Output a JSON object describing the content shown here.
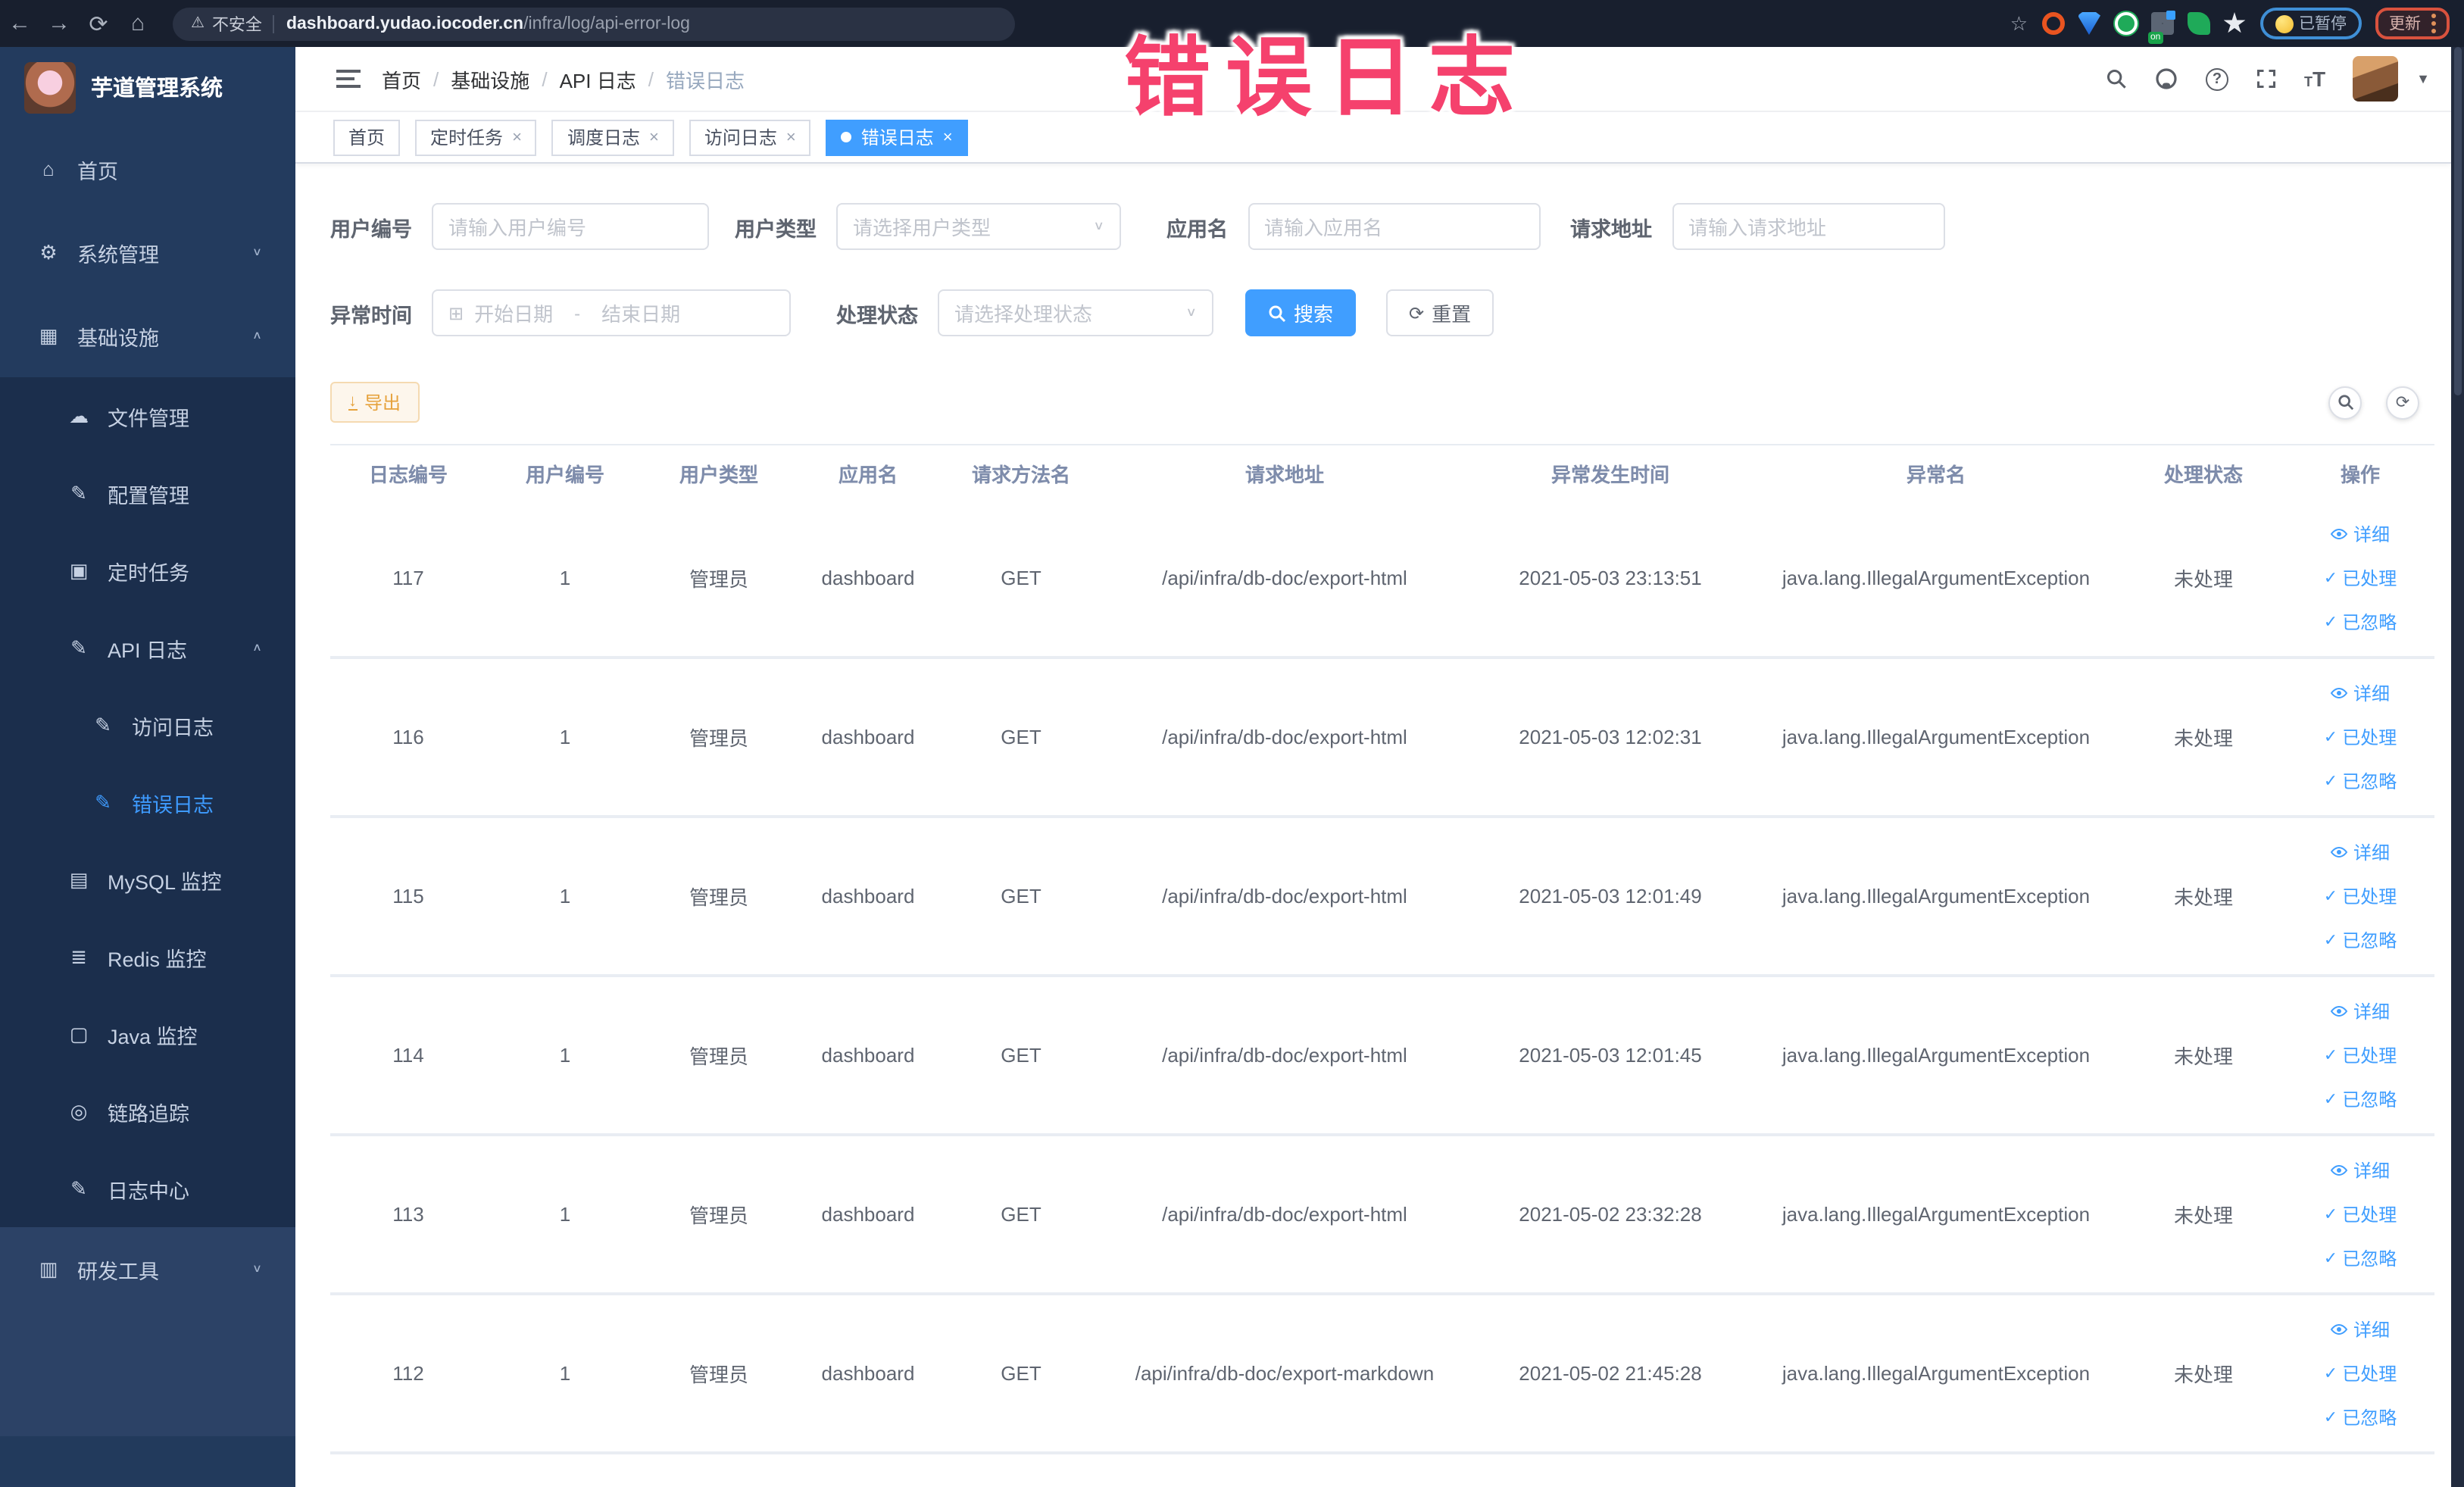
{
  "browser": {
    "security_label": "不安全",
    "url_host": "dashboard.yudao.iocoder.cn",
    "url_path": "/infra/log/api-error-log",
    "extension_on_badge": "on",
    "paused_pill": "已暂停",
    "update_button": "更新"
  },
  "overlay": {
    "text": "错误日志",
    "color": "#f5416d"
  },
  "sidebar": {
    "title": "芋道管理系统",
    "items": [
      {
        "label": "首页",
        "icon": "home-icon",
        "level": 1,
        "section": "base",
        "chevron": "",
        "active": false
      },
      {
        "label": "系统管理",
        "icon": "gear-icon",
        "level": 1,
        "section": "base",
        "chevron": "down",
        "active": false
      },
      {
        "label": "基础设施",
        "icon": "infra-grid-icon",
        "level": 1,
        "section": "base",
        "chevron": "up",
        "active": false
      },
      {
        "label": "文件管理",
        "icon": "cloud-upload-icon",
        "level": 2,
        "section": "sub",
        "chevron": "",
        "active": false
      },
      {
        "label": "配置管理",
        "icon": "edit-icon",
        "level": 2,
        "section": "sub",
        "chevron": "",
        "active": false
      },
      {
        "label": "定时任务",
        "icon": "schedule-icon",
        "level": 2,
        "section": "sub",
        "chevron": "",
        "active": false
      },
      {
        "label": "API 日志",
        "icon": "api-log-icon",
        "level": 2,
        "section": "sub",
        "chevron": "up",
        "active": false
      },
      {
        "label": "访问日志",
        "icon": "access-log-icon",
        "level": 3,
        "section": "sub",
        "chevron": "",
        "active": false
      },
      {
        "label": "错误日志",
        "icon": "error-log-icon",
        "level": 3,
        "section": "sub",
        "chevron": "",
        "active": true
      },
      {
        "label": "MySQL 监控",
        "icon": "mysql-monitor-icon",
        "level": 2,
        "section": "sub",
        "chevron": "",
        "active": false
      },
      {
        "label": "Redis 监控",
        "icon": "redis-monitor-icon",
        "level": 2,
        "section": "sub",
        "chevron": "",
        "active": false
      },
      {
        "label": "Java 监控",
        "icon": "java-monitor-icon",
        "level": 2,
        "section": "sub",
        "chevron": "",
        "active": false
      },
      {
        "label": "链路追踪",
        "icon": "trace-icon",
        "level": 2,
        "section": "sub",
        "chevron": "",
        "active": false
      },
      {
        "label": "日志中心",
        "icon": "log-center-icon",
        "level": 2,
        "section": "sub",
        "chevron": "",
        "active": false
      },
      {
        "label": "研发工具",
        "icon": "dev-tools-icon",
        "level": 1,
        "section": "dev",
        "chevron": "down",
        "active": false
      }
    ]
  },
  "header": {
    "breadcrumb": [
      "首页",
      "基础设施",
      "API 日志",
      "错误日志"
    ]
  },
  "tabs": [
    {
      "label": "首页",
      "closable": false,
      "active": false
    },
    {
      "label": "定时任务",
      "closable": true,
      "active": false
    },
    {
      "label": "调度日志",
      "closable": true,
      "active": false
    },
    {
      "label": "访问日志",
      "closable": true,
      "active": false
    },
    {
      "label": "错误日志",
      "closable": true,
      "active": true
    }
  ],
  "filters": {
    "user_id_label": "用户编号",
    "user_id_placeholder": "请输入用户编号",
    "user_type_label": "用户类型",
    "user_type_placeholder": "请选择用户类型",
    "app_name_label": "应用名",
    "app_name_placeholder": "请输入应用名",
    "request_url_label": "请求地址",
    "request_url_placeholder": "请输入请求地址",
    "exception_time_label": "异常时间",
    "date_start_placeholder": "开始日期",
    "date_separator": "-",
    "date_end_placeholder": "结束日期",
    "process_status_label": "处理状态",
    "process_status_placeholder": "请选择处理状态",
    "search_button": "搜索",
    "reset_button": "重置"
  },
  "toolbar": {
    "export_label": "导出"
  },
  "table": {
    "headers": [
      "日志编号",
      "用户编号",
      "用户类型",
      "应用名",
      "请求方法名",
      "请求地址",
      "异常发生时间",
      "异常名",
      "处理状态",
      "操作"
    ],
    "row_actions": [
      "详细",
      "已处理",
      "已忽略"
    ],
    "rows": [
      {
        "id": "117",
        "user_id": "1",
        "user_type": "管理员",
        "app_name": "dashboard",
        "method": "GET",
        "url": "/api/infra/db-doc/export-html",
        "time": "2021-05-03 23:13:51",
        "exception": "java.lang.IllegalArgumentException",
        "status": "未处理"
      },
      {
        "id": "116",
        "user_id": "1",
        "user_type": "管理员",
        "app_name": "dashboard",
        "method": "GET",
        "url": "/api/infra/db-doc/export-html",
        "time": "2021-05-03 12:02:31",
        "exception": "java.lang.IllegalArgumentException",
        "status": "未处理"
      },
      {
        "id": "115",
        "user_id": "1",
        "user_type": "管理员",
        "app_name": "dashboard",
        "method": "GET",
        "url": "/api/infra/db-doc/export-html",
        "time": "2021-05-03 12:01:49",
        "exception": "java.lang.IllegalArgumentException",
        "status": "未处理"
      },
      {
        "id": "114",
        "user_id": "1",
        "user_type": "管理员",
        "app_name": "dashboard",
        "method": "GET",
        "url": "/api/infra/db-doc/export-html",
        "time": "2021-05-03 12:01:45",
        "exception": "java.lang.IllegalArgumentException",
        "status": "未处理"
      },
      {
        "id": "113",
        "user_id": "1",
        "user_type": "管理员",
        "app_name": "dashboard",
        "method": "GET",
        "url": "/api/infra/db-doc/export-html",
        "time": "2021-05-02 23:32:28",
        "exception": "java.lang.IllegalArgumentException",
        "status": "未处理"
      },
      {
        "id": "112",
        "user_id": "1",
        "user_type": "管理员",
        "app_name": "dashboard",
        "method": "GET",
        "url": "/api/infra/db-doc/export-markdown",
        "time": "2021-05-02 21:45:28",
        "exception": "java.lang.IllegalArgumentException",
        "status": "未处理"
      }
    ]
  },
  "colors": {
    "primary": "#409eff",
    "warning": "#e6a23c"
  }
}
